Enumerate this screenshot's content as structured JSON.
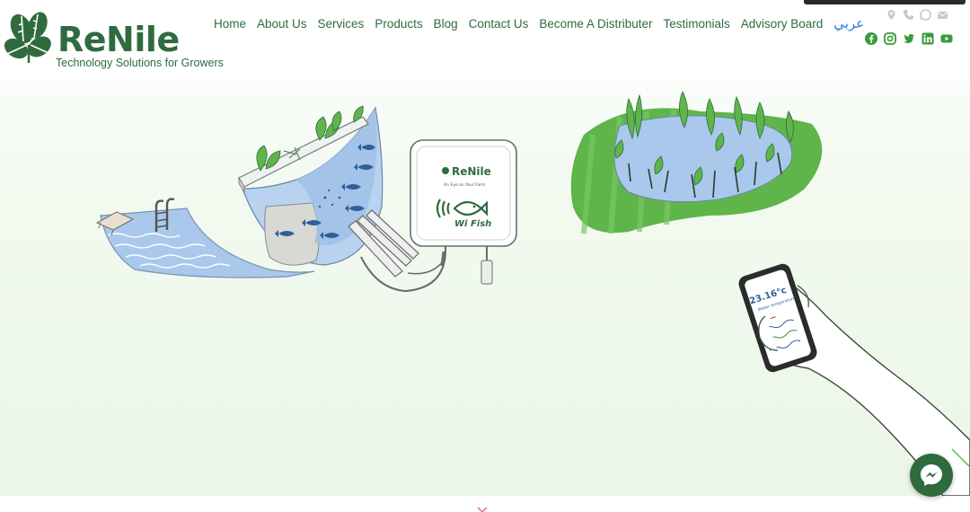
{
  "brand": {
    "name": "ReNile",
    "tagline": "Technology Solutions for Growers",
    "color": "#2f6b3f"
  },
  "nav": {
    "items": [
      {
        "label": "Home"
      },
      {
        "label": "About Us"
      },
      {
        "label": "Services"
      },
      {
        "label": "Products"
      },
      {
        "label": "Blog"
      },
      {
        "label": "Contact Us"
      },
      {
        "label": "Become A Distributer"
      },
      {
        "label": "Testimonials"
      },
      {
        "label": "Advisory Board"
      }
    ],
    "language_label": "عربي"
  },
  "contact_icons": [
    "map-pin-icon",
    "phone-icon",
    "whatsapp-icon",
    "email-icon"
  ],
  "social_icons": [
    "facebook-icon",
    "instagram-icon",
    "twitter-icon",
    "linkedin-icon",
    "youtube-icon"
  ],
  "device": {
    "brand": "ReNile",
    "slogan": "An Eye on Your Farm",
    "product": "Wi Fish"
  },
  "phone": {
    "reading": "23.16°c",
    "label": "Water temperature"
  },
  "colors": {
    "accent_green": "#3a8a3a",
    "leaf_green": "#5fb54a",
    "water_blue": "#a9c8ec",
    "fish_blue": "#2e5f9a"
  }
}
